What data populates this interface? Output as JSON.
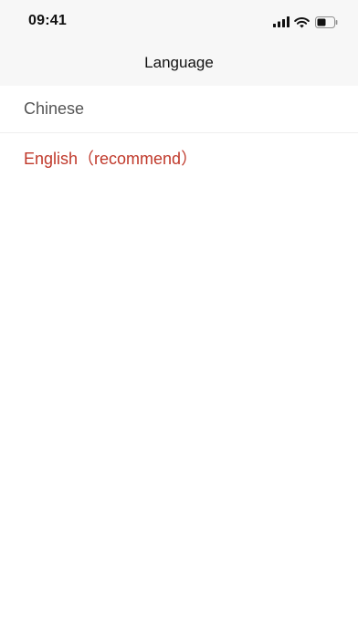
{
  "status_bar": {
    "time": "09:41",
    "icons": [
      "signal-icon",
      "wifi-icon",
      "battery-icon"
    ]
  },
  "nav": {
    "title": "Language"
  },
  "languages": [
    {
      "label": "Chinese",
      "selected": false
    },
    {
      "label": "English（recommend）",
      "selected": true
    }
  ],
  "colors": {
    "selected_text": "#c0392b",
    "normal_text": "#555555",
    "header_background": "#f7f7f7"
  }
}
